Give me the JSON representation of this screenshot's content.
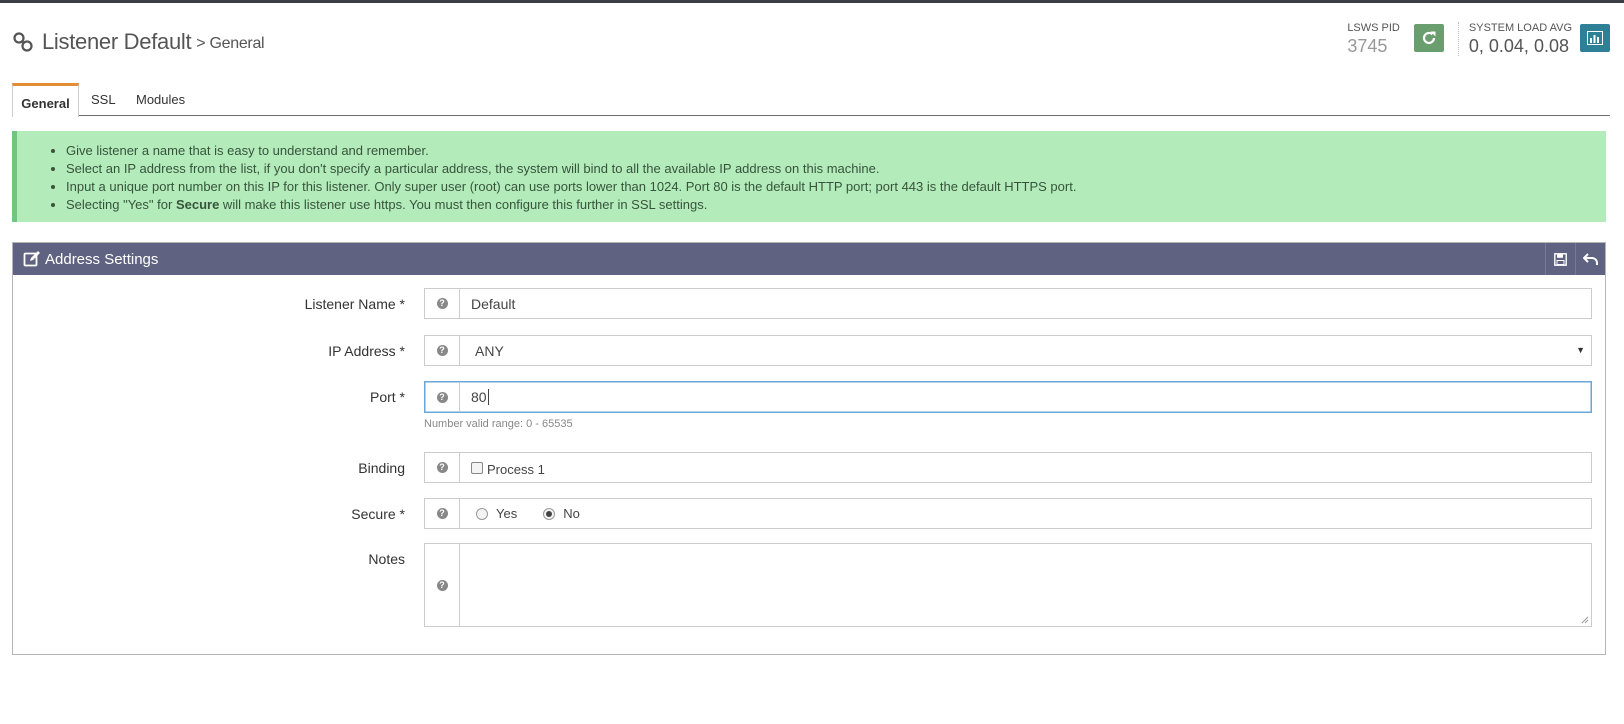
{
  "header": {
    "title": "Listener Default",
    "subtitle": "> General"
  },
  "stats": {
    "pid_label": "LSWS PID",
    "pid_value": "3745",
    "load_label": "SYSTEM LOAD AVG",
    "load_value": "0, 0.04, 0.08"
  },
  "tabs": [
    {
      "label": "General",
      "active": true
    },
    {
      "label": "SSL",
      "active": false
    },
    {
      "label": "Modules",
      "active": false
    }
  ],
  "info": {
    "items": [
      "Give listener a name that is easy to understand and remember.",
      "Select an IP address from the list, if you don't specify a particular address, the system will bind to all the available IP address on this machine.",
      "Input a unique port number on this IP for this listener. Only super user (root) can use ports lower than 1024. Port 80 is the default HTTP port; port 443 is the default HTTPS port."
    ],
    "last_prefix": "Selecting \"Yes\" for ",
    "last_bold": "Secure",
    "last_suffix": " will make this listener use https. You must then configure this further in SSL settings."
  },
  "panel": {
    "title": "Address Settings",
    "fields": {
      "listener_name": {
        "label": "Listener Name *",
        "value": "Default"
      },
      "ip_address": {
        "label": "IP Address *",
        "value": "ANY"
      },
      "port": {
        "label": "Port *",
        "value": "80",
        "hint": "Number valid range: 0 - 65535"
      },
      "binding": {
        "label": "Binding",
        "option": "Process 1",
        "checked": false
      },
      "secure": {
        "label": "Secure *",
        "yes": "Yes",
        "no": "No",
        "selected": "No"
      },
      "notes": {
        "label": "Notes",
        "value": ""
      }
    }
  },
  "colors": {
    "panel_header": "#5f6381",
    "info_bg": "#b3ebbb",
    "tab_accent": "#e38d35",
    "restart_btn": "#6a9e6f",
    "chart_btn": "#2d8096"
  }
}
